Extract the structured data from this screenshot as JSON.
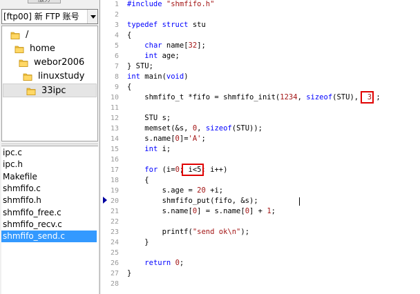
{
  "left_panel": {
    "tab_label": "服务",
    "site_select": {
      "value": "[ftp00] 新 FTP 账号"
    },
    "tree": [
      {
        "label": "/",
        "depth": 0
      },
      {
        "label": "home",
        "depth": 1
      },
      {
        "label": "webor2006",
        "depth": 2
      },
      {
        "label": "linuxstudy",
        "depth": 3
      },
      {
        "label": "33ipc",
        "depth": 4,
        "selected": true
      }
    ],
    "files": [
      {
        "name": "ipc.c"
      },
      {
        "name": "ipc.h"
      },
      {
        "name": "Makefile"
      },
      {
        "name": "shmfifo.c"
      },
      {
        "name": "shmfifo.h"
      },
      {
        "name": "shmfifo_free.c"
      },
      {
        "name": "shmfifo_recv.c"
      },
      {
        "name": "shmfifo_send.c",
        "selected": true
      }
    ]
  },
  "editor": {
    "bookmark_line": 20,
    "lines": [
      {
        "n": "1",
        "tokens": [
          [
            "kw",
            "#include "
          ],
          [
            "str",
            "\"shmfifo.h\""
          ]
        ]
      },
      {
        "n": "2",
        "tokens": []
      },
      {
        "n": "3",
        "tokens": [
          [
            "kw",
            "typedef struct"
          ],
          [
            "",
            " stu"
          ]
        ]
      },
      {
        "n": "4",
        "tokens": [
          [
            "",
            "{"
          ]
        ]
      },
      {
        "n": "5",
        "tokens": [
          [
            "",
            "    "
          ],
          [
            "kw",
            "char"
          ],
          [
            "",
            " name["
          ],
          [
            "num",
            "32"
          ],
          [
            "",
            "];"
          ]
        ]
      },
      {
        "n": "6",
        "tokens": [
          [
            "",
            "    "
          ],
          [
            "kw",
            "int"
          ],
          [
            "",
            " age;"
          ]
        ]
      },
      {
        "n": "7",
        "tokens": [
          [
            "",
            "} STU;"
          ]
        ]
      },
      {
        "n": "8",
        "tokens": [
          [
            "kw",
            "int"
          ],
          [
            "",
            " main("
          ],
          [
            "kw",
            "void"
          ],
          [
            "",
            ")"
          ]
        ]
      },
      {
        "n": "9",
        "tokens": [
          [
            "",
            "{"
          ]
        ]
      },
      {
        "n": "10",
        "tokens": [
          [
            "",
            "    shmfifo_t *fifo = shmfifo_init("
          ],
          [
            "num",
            "1234"
          ],
          [
            "",
            ", "
          ],
          [
            "kw",
            "sizeof"
          ],
          [
            "",
            "(STU), "
          ],
          [
            "hl_num",
            " 3"
          ],
          [
            "",
            " ;"
          ]
        ]
      },
      {
        "n": "11",
        "tokens": []
      },
      {
        "n": "12",
        "tokens": [
          [
            "",
            "    STU s;"
          ]
        ]
      },
      {
        "n": "13",
        "tokens": [
          [
            "",
            "    memset(&s, "
          ],
          [
            "num",
            "0"
          ],
          [
            "",
            ", "
          ],
          [
            "kw",
            "sizeof"
          ],
          [
            "",
            "(STU));"
          ]
        ]
      },
      {
        "n": "14",
        "tokens": [
          [
            "",
            "    s.name["
          ],
          [
            "num",
            "0"
          ],
          [
            "",
            "]="
          ],
          [
            "str",
            "'A'"
          ],
          [
            "",
            ";"
          ]
        ]
      },
      {
        "n": "15",
        "tokens": [
          [
            "",
            "    "
          ],
          [
            "kw",
            "int"
          ],
          [
            "",
            " i;"
          ]
        ]
      },
      {
        "n": "16",
        "tokens": []
      },
      {
        "n": "17",
        "tokens": [
          [
            "",
            "    "
          ],
          [
            "kw",
            "for"
          ],
          [
            "",
            " (i="
          ],
          [
            "num",
            "0"
          ],
          [
            "",
            ";"
          ],
          [
            "hl_text",
            " i<5"
          ],
          [
            "",
            "; i++)"
          ]
        ]
      },
      {
        "n": "18",
        "tokens": [
          [
            "",
            "    {"
          ]
        ]
      },
      {
        "n": "19",
        "tokens": [
          [
            "",
            "        s.age = "
          ],
          [
            "num",
            "20"
          ],
          [
            "",
            " +i;"
          ]
        ]
      },
      {
        "n": "20",
        "tokens": [
          [
            "",
            "        shmfifo_put(fifo, &s);"
          ]
        ]
      },
      {
        "n": "21",
        "tokens": [
          [
            "",
            "        s.name["
          ],
          [
            "num",
            "0"
          ],
          [
            "",
            "] = s.name["
          ],
          [
            "num",
            "0"
          ],
          [
            "",
            "] + "
          ],
          [
            "num",
            "1"
          ],
          [
            "",
            ";"
          ]
        ]
      },
      {
        "n": "22",
        "tokens": []
      },
      {
        "n": "23",
        "tokens": [
          [
            "",
            "        printf("
          ],
          [
            "str",
            "\"send ok\\n\""
          ],
          [
            "",
            ");"
          ]
        ]
      },
      {
        "n": "24",
        "tokens": [
          [
            "",
            "    }"
          ]
        ]
      },
      {
        "n": "25",
        "tokens": []
      },
      {
        "n": "26",
        "tokens": [
          [
            "",
            "    "
          ],
          [
            "kw",
            "return"
          ],
          [
            "",
            " "
          ],
          [
            "num",
            "0"
          ],
          [
            "",
            ";"
          ]
        ]
      },
      {
        "n": "27",
        "tokens": [
          [
            "",
            "}"
          ]
        ]
      },
      {
        "n": "28",
        "tokens": []
      }
    ]
  }
}
